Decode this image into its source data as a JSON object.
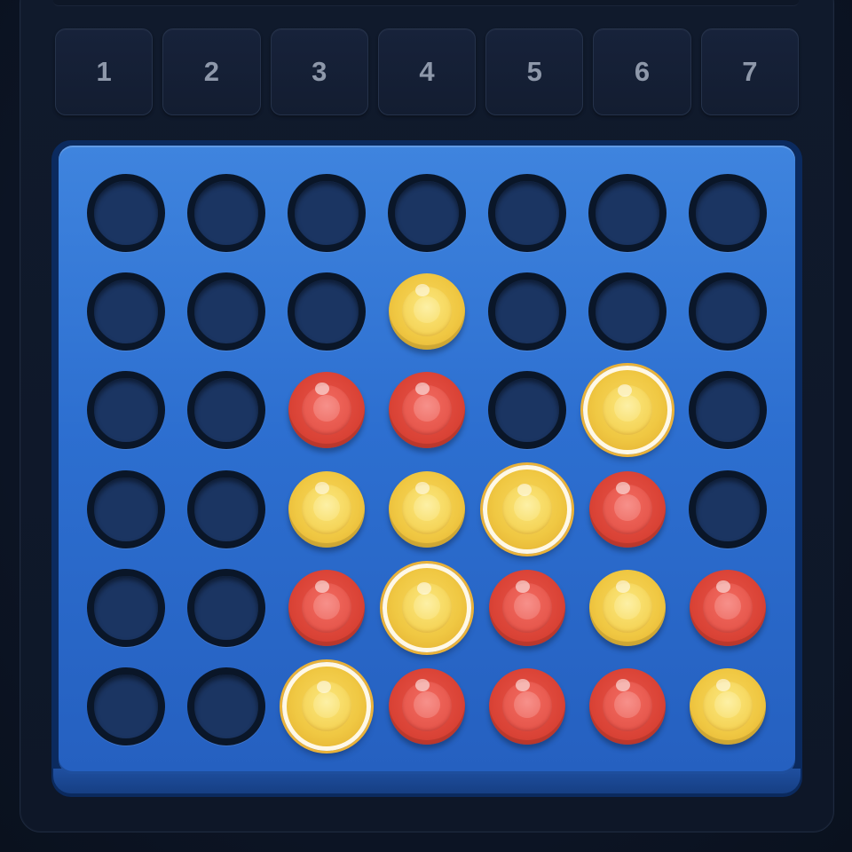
{
  "columns": [
    {
      "label": "1"
    },
    {
      "label": "2"
    },
    {
      "label": "3"
    },
    {
      "label": "4"
    },
    {
      "label": "5"
    },
    {
      "label": "6"
    },
    {
      "label": "7"
    }
  ],
  "board": {
    "rows": 6,
    "cols": 7,
    "grid": [
      [
        "empty",
        "empty",
        "empty",
        "empty",
        "empty",
        "empty",
        "empty"
      ],
      [
        "empty",
        "empty",
        "empty",
        "yellow",
        "empty",
        "empty",
        "empty"
      ],
      [
        "empty",
        "empty",
        "red",
        "red",
        "empty",
        "yellow",
        "empty"
      ],
      [
        "empty",
        "empty",
        "yellow",
        "yellow",
        "yellow",
        "red",
        "empty"
      ],
      [
        "empty",
        "empty",
        "red",
        "yellow",
        "red",
        "yellow",
        "red"
      ],
      [
        "empty",
        "empty",
        "yellow",
        "red",
        "red",
        "red",
        "yellow"
      ]
    ],
    "winning_cells": [
      [
        2,
        5
      ],
      [
        3,
        4
      ],
      [
        4,
        3
      ],
      [
        5,
        2
      ]
    ],
    "winner": "yellow"
  },
  "colors": {
    "board": "#2d6fd0",
    "yellow_disc": "#f0c843",
    "red_disc": "#da4336",
    "win_ring": "#fff8e6",
    "hole": "#1b3562",
    "background": "#0b1322"
  }
}
